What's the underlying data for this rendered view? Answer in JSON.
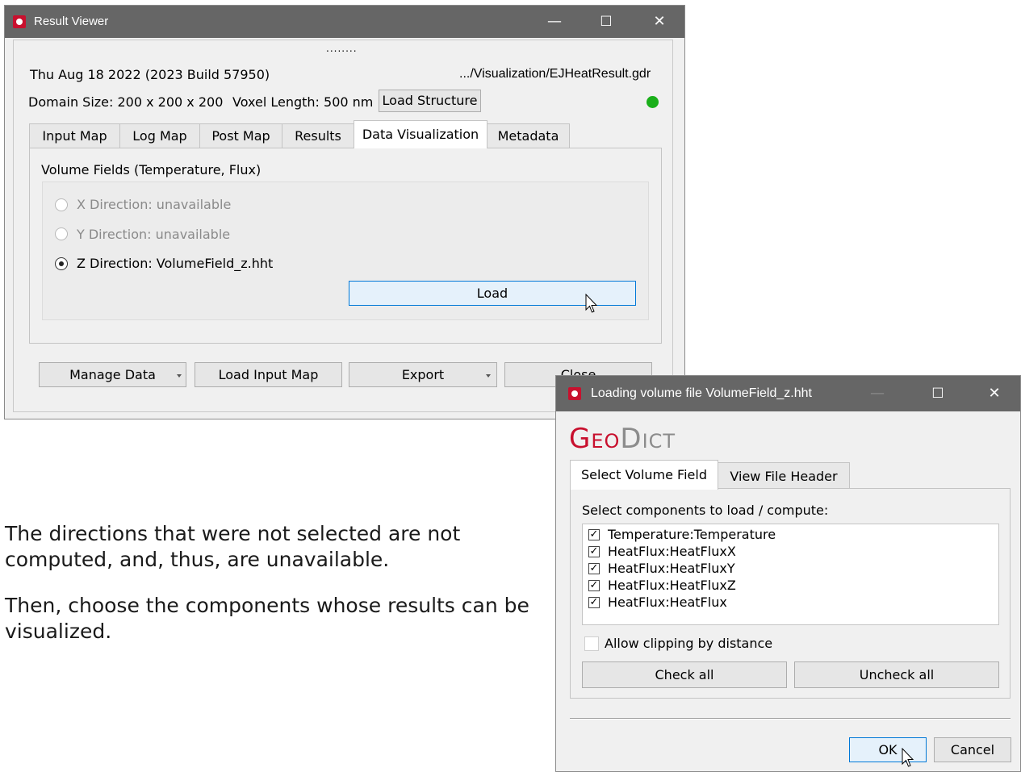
{
  "result_viewer": {
    "title": "Result Viewer",
    "grip": "........",
    "date_build": "Thu Aug 18 2022 (2023 Build 57950)",
    "file_path": ".../Visualization/EJHeatResult.gdr",
    "domain_size": "Domain Size: 200 x 200 x 200",
    "voxel_length": "Voxel Length: 500 nm",
    "load_structure": "Load Structure",
    "status_color": "#1aaf1a",
    "tabs": [
      "Input Map",
      "Log Map",
      "Post Map",
      "Results",
      "Data Visualization",
      "Metadata"
    ],
    "active_tab": "Data Visualization",
    "volume_fields_label": "Volume Fields (Temperature, Flux)",
    "directions": [
      {
        "label": "X Direction:  unavailable",
        "selected": false,
        "enabled": false
      },
      {
        "label": "Y Direction:  unavailable",
        "selected": false,
        "enabled": false
      },
      {
        "label": "Z Direction: VolumeField_z.hht",
        "selected": true,
        "enabled": true
      }
    ],
    "load_button": "Load",
    "bottom_buttons": {
      "manage_data": "Manage Data",
      "load_input_map": "Load Input Map",
      "export": "Export",
      "close": "Close"
    }
  },
  "instructions": {
    "paragraph1": "The directions that were not selected are not computed, and, thus, are unavailable.",
    "paragraph2": "Then, choose the components whose results can be visualized."
  },
  "loading_dialog": {
    "title": "Loading volume file VolumeField_z.hht",
    "logo": "GeoDict",
    "tabs": [
      "Select Volume Field",
      "View File Header"
    ],
    "active_tab": "Select Volume Field",
    "components_label": "Select components to load / compute:",
    "components": [
      {
        "label": "Temperature:Temperature",
        "checked": true
      },
      {
        "label": "HeatFlux:HeatFluxX",
        "checked": true
      },
      {
        "label": "HeatFlux:HeatFluxY",
        "checked": true
      },
      {
        "label": "HeatFlux:HeatFluxZ",
        "checked": true
      },
      {
        "label": "HeatFlux:HeatFlux",
        "checked": true
      }
    ],
    "allow_clipping": {
      "label": "Allow clipping by distance",
      "checked": false
    },
    "check_all": "Check all",
    "uncheck_all": "Uncheck all",
    "ok": "OK",
    "cancel": "Cancel"
  },
  "colors": {
    "titlebar": "#666666",
    "logo_red": "#c8102e",
    "logo_gray": "#8c8c8c",
    "focus_blue": "#0078d7"
  }
}
